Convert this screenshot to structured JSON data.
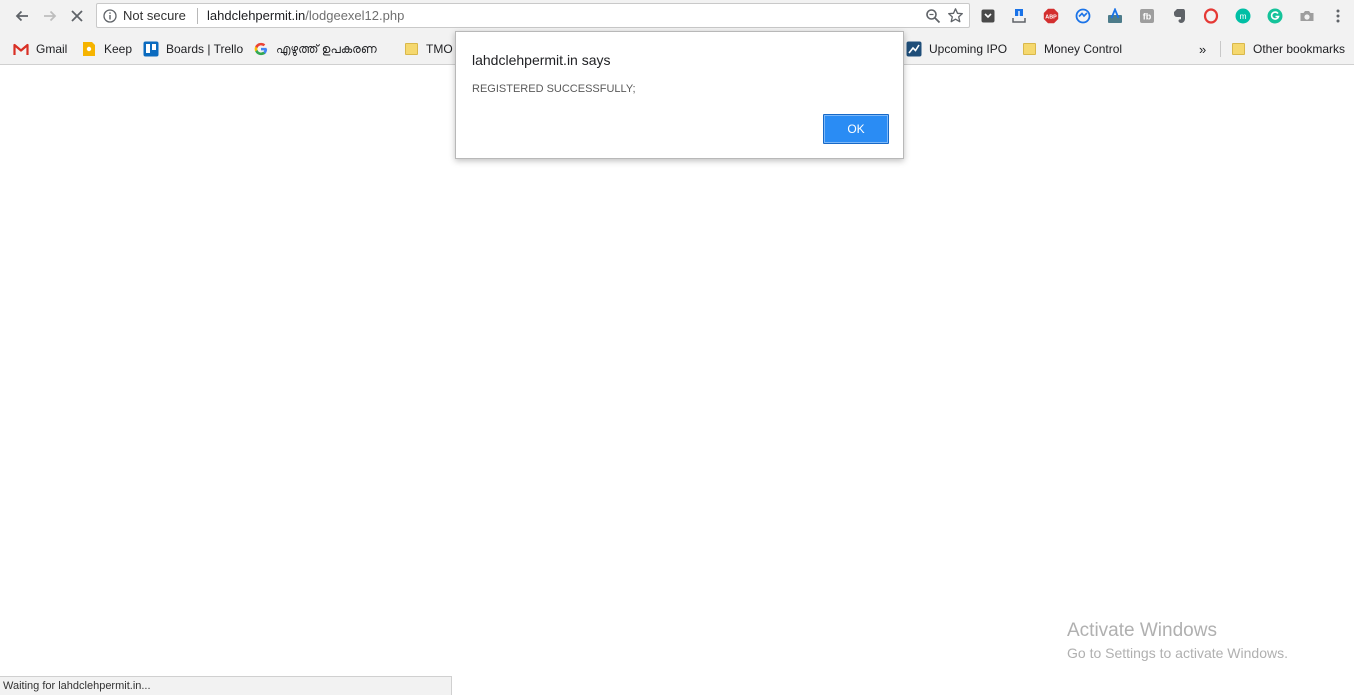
{
  "browser": {
    "security_label": "Not secure",
    "url_domain": "lahdclehpermit.in",
    "url_path": "/lodgeexel12.php",
    "extensions": [
      "pocket-icon",
      "download-icon",
      "adblock-plus-icon",
      "sync-icon",
      "extension-a-icon",
      "extension-b-icon",
      "evernote-icon",
      "opera-icon",
      "mate-icon",
      "grammarly-icon",
      "camera-icon"
    ]
  },
  "bookmarks": {
    "items": [
      {
        "label": "Gmail",
        "icon": "gmail-icon"
      },
      {
        "label": "Keep",
        "icon": "keep-icon"
      },
      {
        "label": "Boards | Trello",
        "icon": "trello-icon"
      },
      {
        "label": "എഴുത്ത് ഉപകരണ",
        "icon": "google-icon"
      },
      {
        "label": "TMO",
        "icon": "folder-icon"
      },
      {
        "label": "Upcoming IPO",
        "icon": "site-icon"
      },
      {
        "label": "Money Control",
        "icon": "folder-icon"
      }
    ],
    "overflow": "»",
    "other": "Other bookmarks"
  },
  "dialog": {
    "title": "lahdclehpermit.in says",
    "message": "REGISTERED SUCCESSFULLY;",
    "ok_label": "OK"
  },
  "watermark": {
    "title": "Activate Windows",
    "subtitle": "Go to Settings to activate Windows."
  },
  "status": {
    "text": "Waiting for lahdclehpermit.in..."
  },
  "colors": {
    "accent": "#2a8cf4",
    "chrome_bg": "#f2f2f2"
  }
}
